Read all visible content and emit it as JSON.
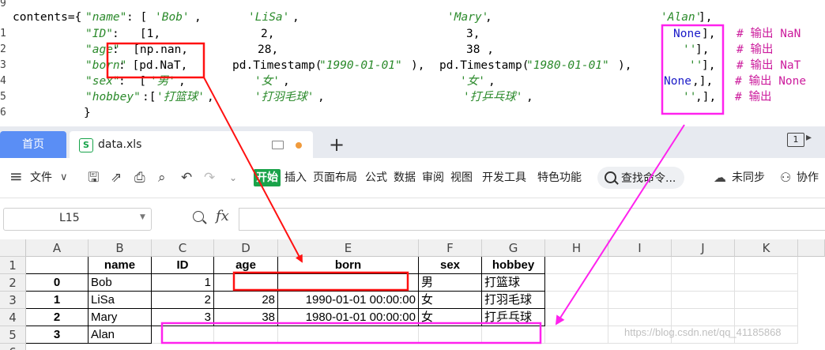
{
  "code": {
    "line_numbers": [
      "9",
      "1",
      "2",
      "3",
      "4",
      "5",
      "6"
    ],
    "line1": {
      "p1": "contents={",
      "k1": "\"name\"",
      "p2": ": [",
      "v1": "'Bob'",
      "p3": ",",
      "v2": "'LiSa'",
      "p4": ",",
      "v3": "'Mary'",
      "p5": ",",
      "v4": "'Alan'",
      "p6": "],"
    },
    "line2": {
      "k1": "\"ID\"",
      "p1": ":   [1,",
      "p2": "2,",
      "p3": "3,",
      "n1": "None",
      "p4": "],",
      "c1": "# 输出 NaN"
    },
    "line3": {
      "k1": "\"age\"",
      "p1": ":  [np.nan,",
      "p2": "28,",
      "p3": "38 ,",
      "s1": "''",
      "p4": "],",
      "c1": "# 输出"
    },
    "line4": {
      "k1": "\"born\"",
      "p1": ": [pd.NaT,",
      "p2": "pd.Timestamp(",
      "s1": "\"1990-01-01\"",
      "p3": "),",
      "p4": "pd.Timestamp(",
      "s2": "\"1980-01-01\"",
      "p5": "),",
      "s3": "''",
      "p6": "],",
      "c1": "# 输出 NaT"
    },
    "line5": {
      "k1": "\"sex\"",
      "p1": ":  [",
      "s1": "'男'",
      "p2": ",",
      "s2": "'女'",
      "p3": ",",
      "s3": "'女'",
      "p4": ",",
      "n1": "None",
      "p5": ",],",
      "c1": "# 输出 None"
    },
    "line6": {
      "k1": "\"hobbey\"",
      "p1": ":[",
      "s1": "'打篮球'",
      "p2": ",",
      "s2": "'打羽毛球'",
      "p3": ",",
      "s3": "'打乒乓球'",
      "p4": ",",
      "s4": "''",
      "p5": ",],",
      "c1": "# 输出"
    },
    "line7": {
      "p1": "}"
    }
  },
  "tabs": {
    "home": "首页",
    "file_icon": "S",
    "file_name": "data.xls",
    "plus": "+",
    "window_count": "1"
  },
  "toolbar": {
    "menu_icon": "≡",
    "file": "文件",
    "start": "开始",
    "insert": "插入",
    "page_layout": "页面布局",
    "formula": "公式",
    "data": "数据",
    "review": "审阅",
    "view": "视图",
    "dev_tools": "开发工具",
    "features": "特色功能",
    "search": "查找命令...",
    "sync": "未同步",
    "collab": "协作"
  },
  "formula_bar": {
    "cell_ref": "L15",
    "fx": "fx"
  },
  "sheet": {
    "columns": [
      "A",
      "B",
      "C",
      "D",
      "E",
      "F",
      "G",
      "H",
      "I",
      "J",
      "K"
    ],
    "rows": [
      "1",
      "2",
      "3",
      "4",
      "5",
      "6"
    ],
    "header": [
      "",
      "name",
      "ID",
      "age",
      "born",
      "sex",
      "hobbey"
    ],
    "data": [
      [
        "0",
        "Bob",
        "1",
        "",
        "",
        "男",
        "打篮球"
      ],
      [
        "1",
        "LiSa",
        "2",
        "28",
        "1990-01-01 00:00:00",
        "女",
        "打羽毛球"
      ],
      [
        "2",
        "Mary",
        "3",
        "38",
        "1980-01-01 00:00:00",
        "女",
        "打乒乓球"
      ],
      [
        "3",
        "Alan",
        "",
        "",
        "",
        "",
        ""
      ]
    ]
  },
  "watermark": "https://blog.csdn.net/qq_41185868",
  "annotation_colors": {
    "red": "#ff1111",
    "magenta": "#ff22ee"
  }
}
